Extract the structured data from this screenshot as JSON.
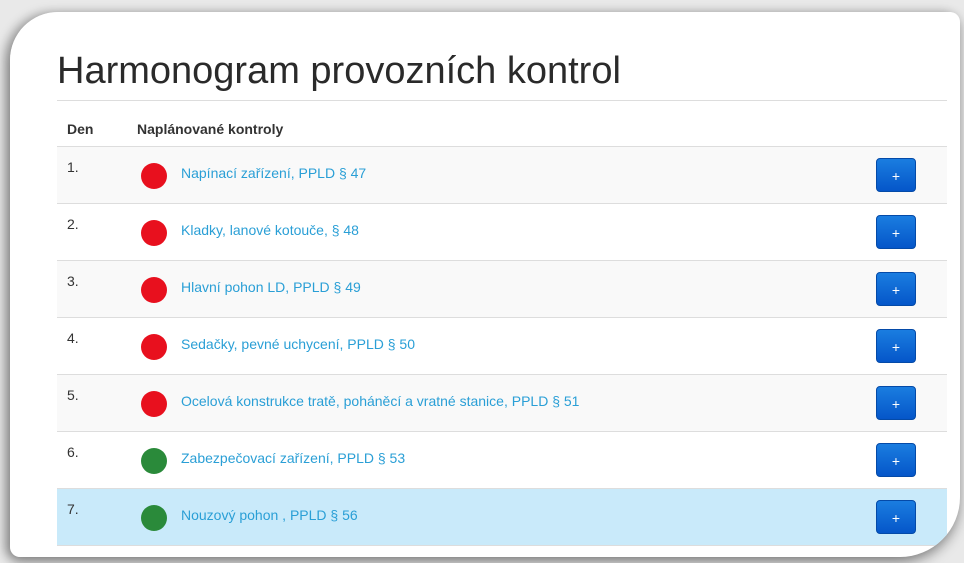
{
  "page": {
    "title": "Harmonogram provozních kontrol"
  },
  "table": {
    "headers": {
      "day": "Den",
      "checks": "Naplánované kontroly"
    },
    "rows": [
      {
        "day": "1.",
        "label": "Napínací zařízení, PPLD § 47",
        "status": "red",
        "button": "+"
      },
      {
        "day": "2.",
        "label": "Kladky, lanové kotouče, § 48",
        "status": "red",
        "button": "+"
      },
      {
        "day": "3.",
        "label": "Hlavní pohon LD, PPLD § 49",
        "status": "red",
        "button": "+"
      },
      {
        "day": "4.",
        "label": "Sedačky, pevné uchycení, PPLD § 50",
        "status": "red",
        "button": "+"
      },
      {
        "day": "5.",
        "label": "Ocelová konstrukce tratě, poháněcí a vratné stanice, PPLD § 51",
        "status": "red",
        "button": "+"
      },
      {
        "day": "6.",
        "label": "Zabezpečovací zařízení, PPLD § 53",
        "status": "green",
        "button": "+"
      },
      {
        "day": "7.",
        "label": "Nouzový pohon , PPLD § 56",
        "status": "green",
        "button": "+",
        "highlighted": true
      }
    ]
  },
  "colors": {
    "red": "#e8101e",
    "green": "#2a8a3a",
    "link": "#2a9fd6",
    "button": "#0d66d6",
    "highlight": "#c9eafa"
  }
}
